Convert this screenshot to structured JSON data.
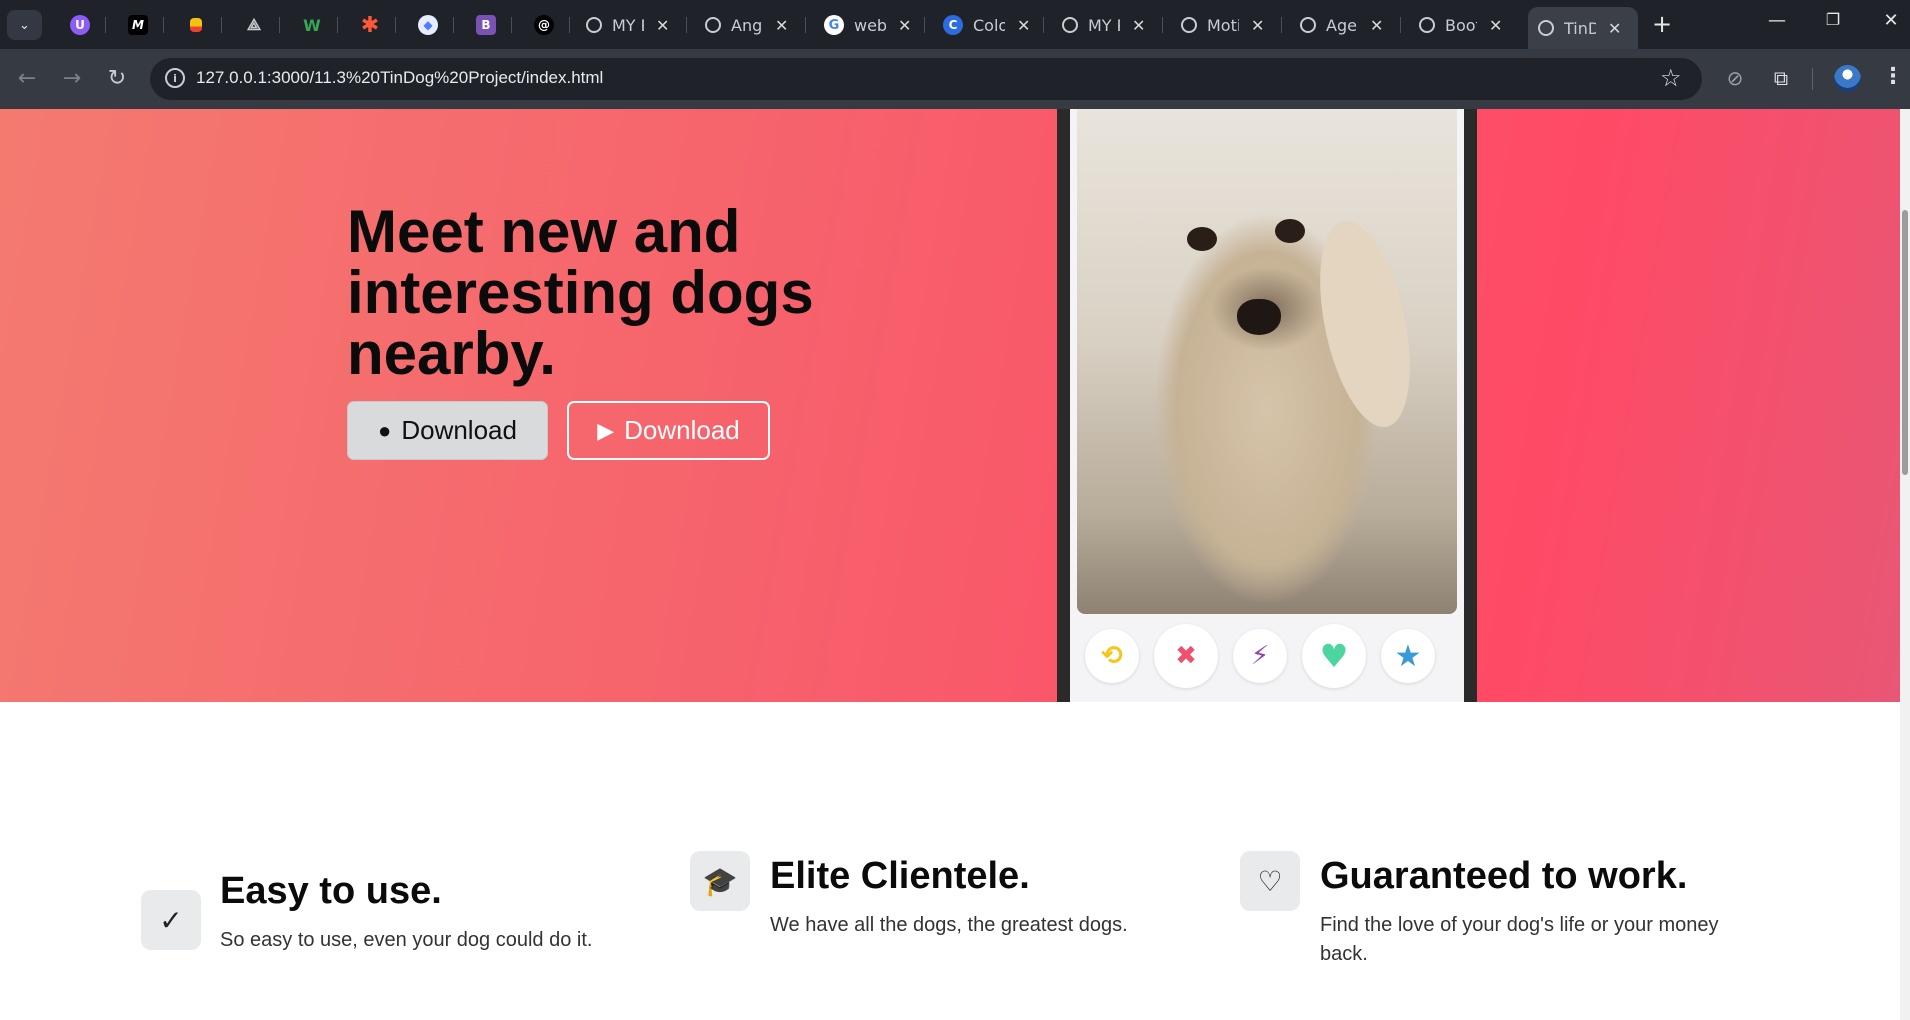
{
  "browser": {
    "tabs": [
      {
        "title": "",
        "icon": "purple-u-icon",
        "color": "#8b5cf6"
      },
      {
        "title": "",
        "icon": "m-logo-icon",
        "color": "#000000"
      },
      {
        "title": "",
        "icon": "yellow-flag-icon",
        "color": "#f4c20d"
      },
      {
        "title": "",
        "icon": "network-icon",
        "color": "#c9ccd1"
      },
      {
        "title": "",
        "icon": "colorful-w-icon",
        "color": "#34a853"
      },
      {
        "title": "",
        "icon": "asterisk-icon",
        "color": "#ff5a36"
      },
      {
        "title": "",
        "icon": "eye-disc-icon",
        "color": "#4f7cff"
      },
      {
        "title": "",
        "icon": "bootstrap-b-icon",
        "color": "#7952b3"
      },
      {
        "title": "",
        "icon": "ai-swirl-icon",
        "color": "#111111"
      },
      {
        "title": "MY P",
        "icon": "globe-icon"
      },
      {
        "title": "Angu",
        "icon": "globe-icon"
      },
      {
        "title": "web-",
        "icon": "google-g-icon"
      },
      {
        "title": "Colo",
        "icon": "blue-c-icon"
      },
      {
        "title": "MY P",
        "icon": "globe-icon"
      },
      {
        "title": "Moti",
        "icon": "globe-icon"
      },
      {
        "title": "Agen",
        "icon": "globe-icon"
      },
      {
        "title": "Boot",
        "icon": "globe-icon"
      },
      {
        "title": "TinD",
        "icon": "globe-icon",
        "active": true
      }
    ],
    "url": "127.0.0.1:3000/11.3%20TinDog%20Project/index.html"
  },
  "hero": {
    "headline": "Meet new and interesting dogs nearby.",
    "buttons": [
      {
        "label": "Download",
        "icon": "apple-icon",
        "style": "dark"
      },
      {
        "label": "Download",
        "icon": "google-play-icon",
        "style": "outline"
      }
    ],
    "phone_actions": [
      {
        "icon": "undo-icon",
        "glyph": "⟲",
        "color": "#f5c518"
      },
      {
        "icon": "close-x-icon",
        "glyph": "✖",
        "color": "#f0506e"
      },
      {
        "icon": "lightning-icon",
        "glyph": "⚡",
        "color": "#8e44ad"
      },
      {
        "icon": "heart-icon",
        "glyph": "♥",
        "color": "#4cd5a0"
      },
      {
        "icon": "star-icon",
        "glyph": "★",
        "color": "#3a9ad9"
      }
    ],
    "gradient_colors": [
      "#f47a70",
      "#ff4a66"
    ]
  },
  "features": [
    {
      "icon": "check-circle-icon",
      "glyph": "✓",
      "title": "Easy to use.",
      "text": "So easy to use, even your dog could do it."
    },
    {
      "icon": "graduation-cap-icon",
      "glyph": "🎓",
      "title": "Elite Clientele.",
      "text": "We have all the dogs, the greatest dogs."
    },
    {
      "icon": "heart-arrow-icon",
      "glyph": "♡",
      "title": "Guaranteed to work.",
      "text": "Find the love of your dog's life or your money back."
    }
  ]
}
